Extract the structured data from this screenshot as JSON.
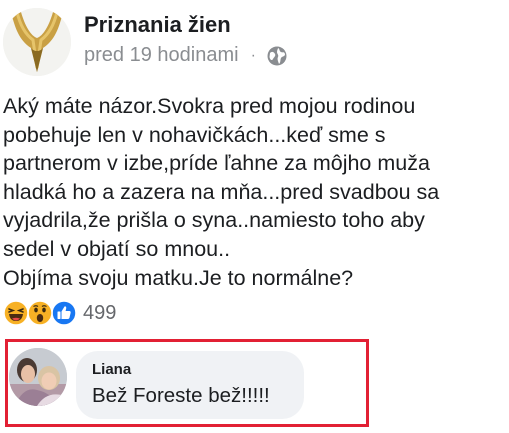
{
  "post": {
    "page_name": "Priznania žien",
    "timestamp": "pred 19 hodinami",
    "separator": "·",
    "privacy_icon": "globe-icon",
    "lines": [
      "Aký máte názor.Svokra pred mojou rodinou",
      "pobehuje len v nohavičkách...keď sme s",
      "partnerom v izbe,príde ľahne za môjho muža",
      "hladká ho a zazera na mňa...pred svadbou sa",
      "vyjadrila,že prišla o syna..namiesto toho aby",
      "sedel v objatí so mnou..",
      "Objíma svoju matku.Je to normálne?"
    ]
  },
  "reactions": {
    "icons": [
      "haha-icon",
      "wow-icon",
      "like-icon"
    ],
    "count": "499"
  },
  "comment": {
    "author": "Liana",
    "text": "Bež Foreste bež!!!!!",
    "highlight_color": "#e22034"
  },
  "colors": {
    "like_blue": "#1877f2",
    "reaction_yellow": "#f7b125",
    "meta_gray": "#8a8d91",
    "bubble_bg": "#f0f2f5"
  }
}
